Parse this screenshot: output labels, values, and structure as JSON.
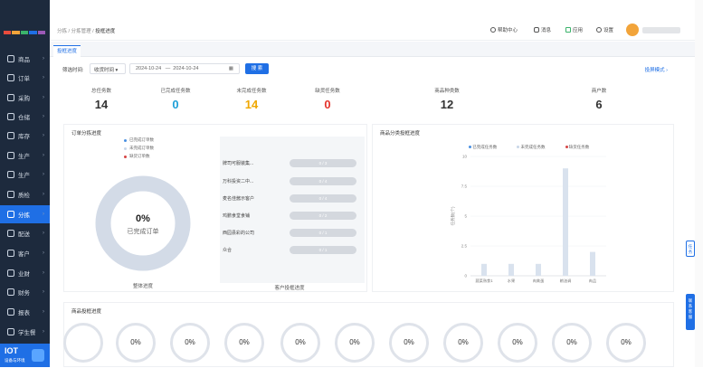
{
  "sidebar": {
    "items": [
      {
        "label": "商品",
        "top": 0
      },
      {
        "label": "订单"
      },
      {
        "label": "采购"
      },
      {
        "label": "仓储"
      },
      {
        "label": "库存"
      },
      {
        "label": "生产"
      },
      {
        "label": "生产"
      },
      {
        "label": "质检"
      },
      {
        "label": "分拣"
      },
      {
        "label": "配送"
      },
      {
        "label": "客户"
      },
      {
        "label": "业财"
      },
      {
        "label": "财务"
      },
      {
        "label": "报表"
      },
      {
        "label": "学生餐"
      }
    ],
    "active_index": 8,
    "iot_title": "IOT",
    "iot_sub": "设备与环境"
  },
  "topbar": {
    "crumb_1": "分拣",
    "crumb_2": "分拣管理",
    "crumb_3": "投框进度",
    "help": "帮助中心",
    "message": "消息",
    "apply": "应用",
    "settings": "设置"
  },
  "tab": {
    "label": "投框进度"
  },
  "filter": {
    "label": "筛选时间:",
    "select_value": "收货时间",
    "date_start": "2024-10-24",
    "date_sep": "—",
    "date_end": "2024-10-24",
    "search_button": "搜 索",
    "mode_link": "投屏模式 ›"
  },
  "stats": {
    "total_orders": {
      "label": "总任务数",
      "value": "14"
    },
    "done_orders": {
      "label": "已完成任务数",
      "value": "0"
    },
    "undone_orders": {
      "label": "未完成任务数",
      "value": "14"
    },
    "short_orders": {
      "label": "缺货任务数",
      "value": "0"
    },
    "product_kinds": {
      "label": "商品种类数",
      "value": "12"
    },
    "customers": {
      "label": "商户数",
      "value": "6"
    }
  },
  "order_panel": {
    "title": "订单分拣进度",
    "legend": [
      "已完成订单数",
      "未完成订单数",
      "缺货订单数"
    ],
    "donut_value": "0%",
    "donut_label": "已完成订单",
    "overall_caption": "整体进度",
    "customer_caption": "客户投框进度",
    "rows": [
      {
        "name": "牌司可服装集...",
        "value": "0 / 3"
      },
      {
        "name": "万科投资二中...",
        "value": "0 / 4"
      },
      {
        "name": "麦名佳酱示客户",
        "value": "0 / 4"
      },
      {
        "name": "鸡鹏食堂食铺",
        "value": "0 / 2"
      },
      {
        "name": "西园县彩的公司",
        "value": "0 / 1"
      },
      {
        "name": "众合",
        "value": "0 / 1"
      }
    ]
  },
  "category_panel": {
    "title": "商品分类投框进度",
    "legend": [
      "已完成任务数",
      "未完成任务数",
      "缺货任务数"
    ],
    "legend_colors": [
      "#4a90e2",
      "#c9d6e8",
      "#d64545"
    ]
  },
  "chart_data": {
    "type": "bar",
    "categories": [
      "蔬菜熟食1",
      "水果",
      "肉禽蛋",
      "粮油调",
      "肉品"
    ],
    "series": [
      {
        "name": "已完成任务数",
        "values": [
          0,
          0,
          0,
          0,
          0
        ]
      },
      {
        "name": "未完成任务数",
        "values": [
          1,
          1,
          1,
          9,
          2
        ]
      },
      {
        "name": "缺货任务数",
        "values": [
          0,
          0,
          0,
          0,
          0
        ]
      }
    ],
    "ylabel": "任务数(个)",
    "yticks": [
      0,
      2.5,
      5,
      7.5,
      10
    ],
    "ylim": [
      0,
      10
    ]
  },
  "bottom_panel": {
    "title": "商品投框进度",
    "circles": [
      "",
      "0%",
      "0%",
      "0%",
      "0%",
      "0%",
      "0%",
      "0%",
      "0%",
      "0%",
      "0%",
      "0%"
    ]
  },
  "float": {
    "btn1": "任务",
    "btn2": "联系客服"
  },
  "colors": {
    "primary": "#1f6fe5",
    "sidebar_bg": "#1d2a3d",
    "total": "#333333",
    "done": "#1fa0d8",
    "undone": "#f0a800",
    "short": "#e5342d"
  }
}
